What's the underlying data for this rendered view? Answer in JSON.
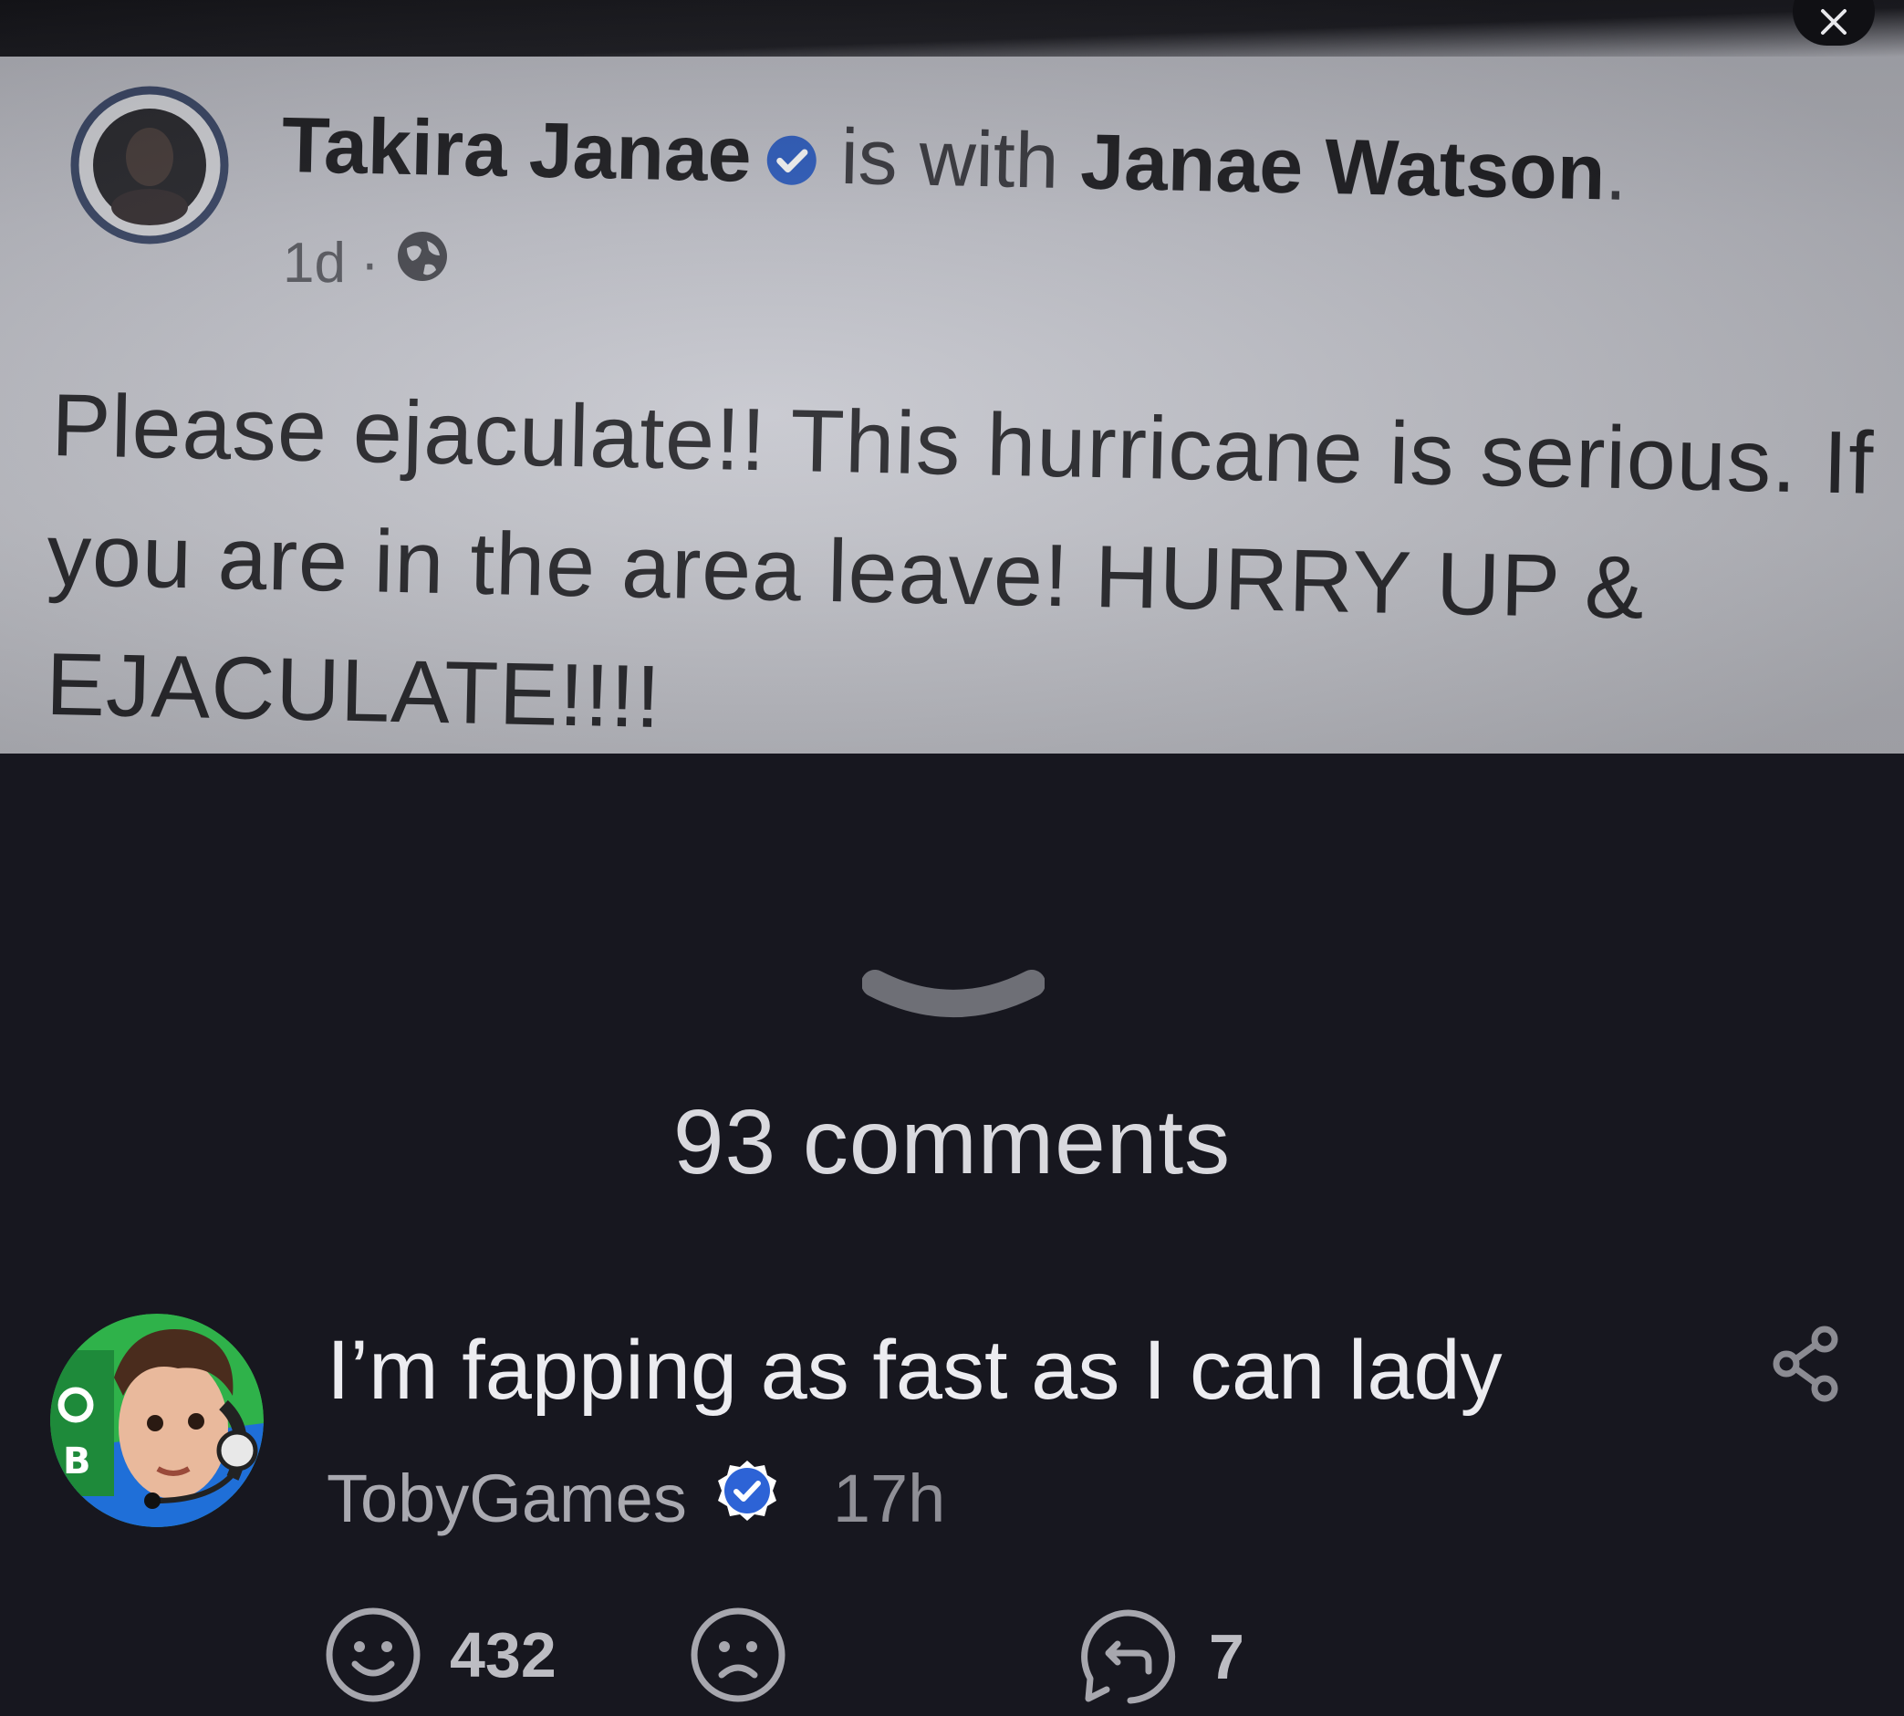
{
  "post": {
    "author": "Takira Janae",
    "with_text": "is with",
    "tagged": "Janae Watson",
    "punctuation": ".",
    "time": "1d",
    "meta_separator": "·",
    "body_lines": [
      "Please ejaculate!! This hurricane is serious. If",
      "you are in the area leave! HURRY UP &",
      "EJACULATE!!!!"
    ]
  },
  "comments_header": "93 comments",
  "comment": {
    "text": "I’m fapping as fast as I can lady",
    "author": "TobyGames",
    "time": "17h",
    "reactions": {
      "happy_count": "432",
      "replies_count": "7"
    }
  },
  "colors": {
    "background": "#17171f",
    "verified_blue": "#2d63d6",
    "text_primary": "#ececf0"
  }
}
